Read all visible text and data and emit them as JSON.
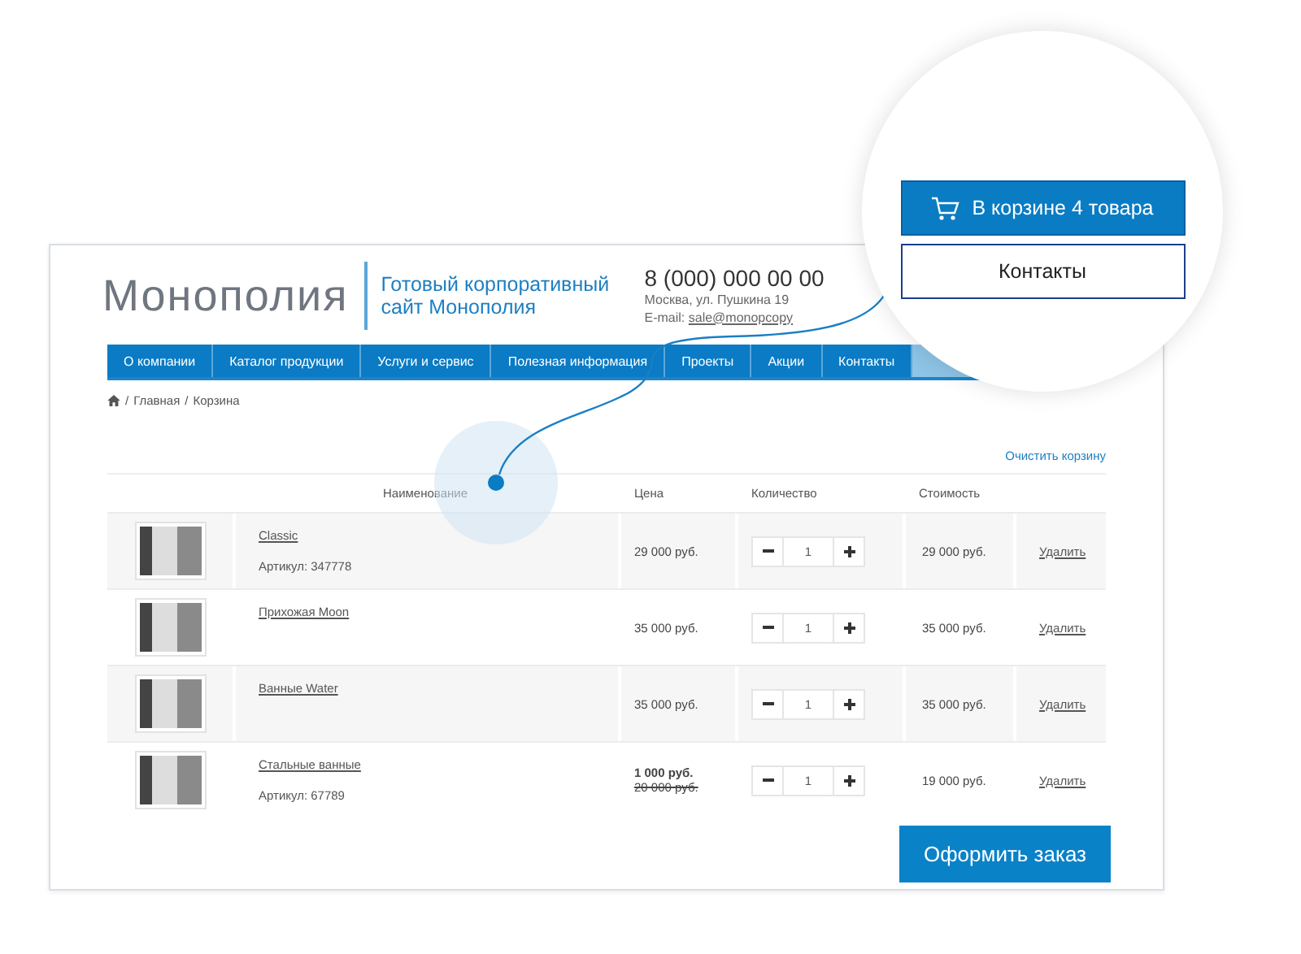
{
  "header": {
    "logo": "Монополия",
    "tagline": "Готовый корпоративный сайт Монополия",
    "phone": "8 (000) 000 00 00",
    "address": "Москва, ул. Пушкина 19",
    "email_label": "E-mail:",
    "email": "sale@monopcopy"
  },
  "nav": [
    "О компании",
    "Каталог продукции",
    "Услуги и сервис",
    "Полезная информация",
    "Проекты",
    "Акции",
    "Контакты"
  ],
  "breadcrumbs": [
    {
      "separator": "/",
      "label": "Главная"
    },
    {
      "separator": "/",
      "label": "Корзина"
    }
  ],
  "clear_cart": "Очистить корзину",
  "table": {
    "columns": [
      "Наименование",
      "Цена",
      "Количество",
      "Стоимость"
    ],
    "rows": [
      {
        "name": "Classic",
        "article": "Артикул: 347778",
        "price": "29 000 руб.",
        "quantity": "1",
        "total": "29 000 руб.",
        "delete": "Удалить"
      },
      {
        "name": "Прихожая Moon",
        "price": "35 000 руб.",
        "quantity": "1",
        "total": "35 000 руб.",
        "delete": "Удалить"
      },
      {
        "name": "Ванные Water",
        "price": "35 000 руб.",
        "quantity": "1",
        "total": "35 000 руб.",
        "delete": "Удалить"
      },
      {
        "name": "Стальные ванные",
        "article": "Артикул: 67789",
        "price": "1 000 руб.",
        "old_price": "20 000 руб.",
        "quantity": "1",
        "total": "19 000 руб.",
        "delete": "Удалить"
      }
    ]
  },
  "checkout": "Оформить заказ",
  "callout": {
    "cart_button": "В корзине 4 товара",
    "contacts_button": "Контакты"
  }
}
